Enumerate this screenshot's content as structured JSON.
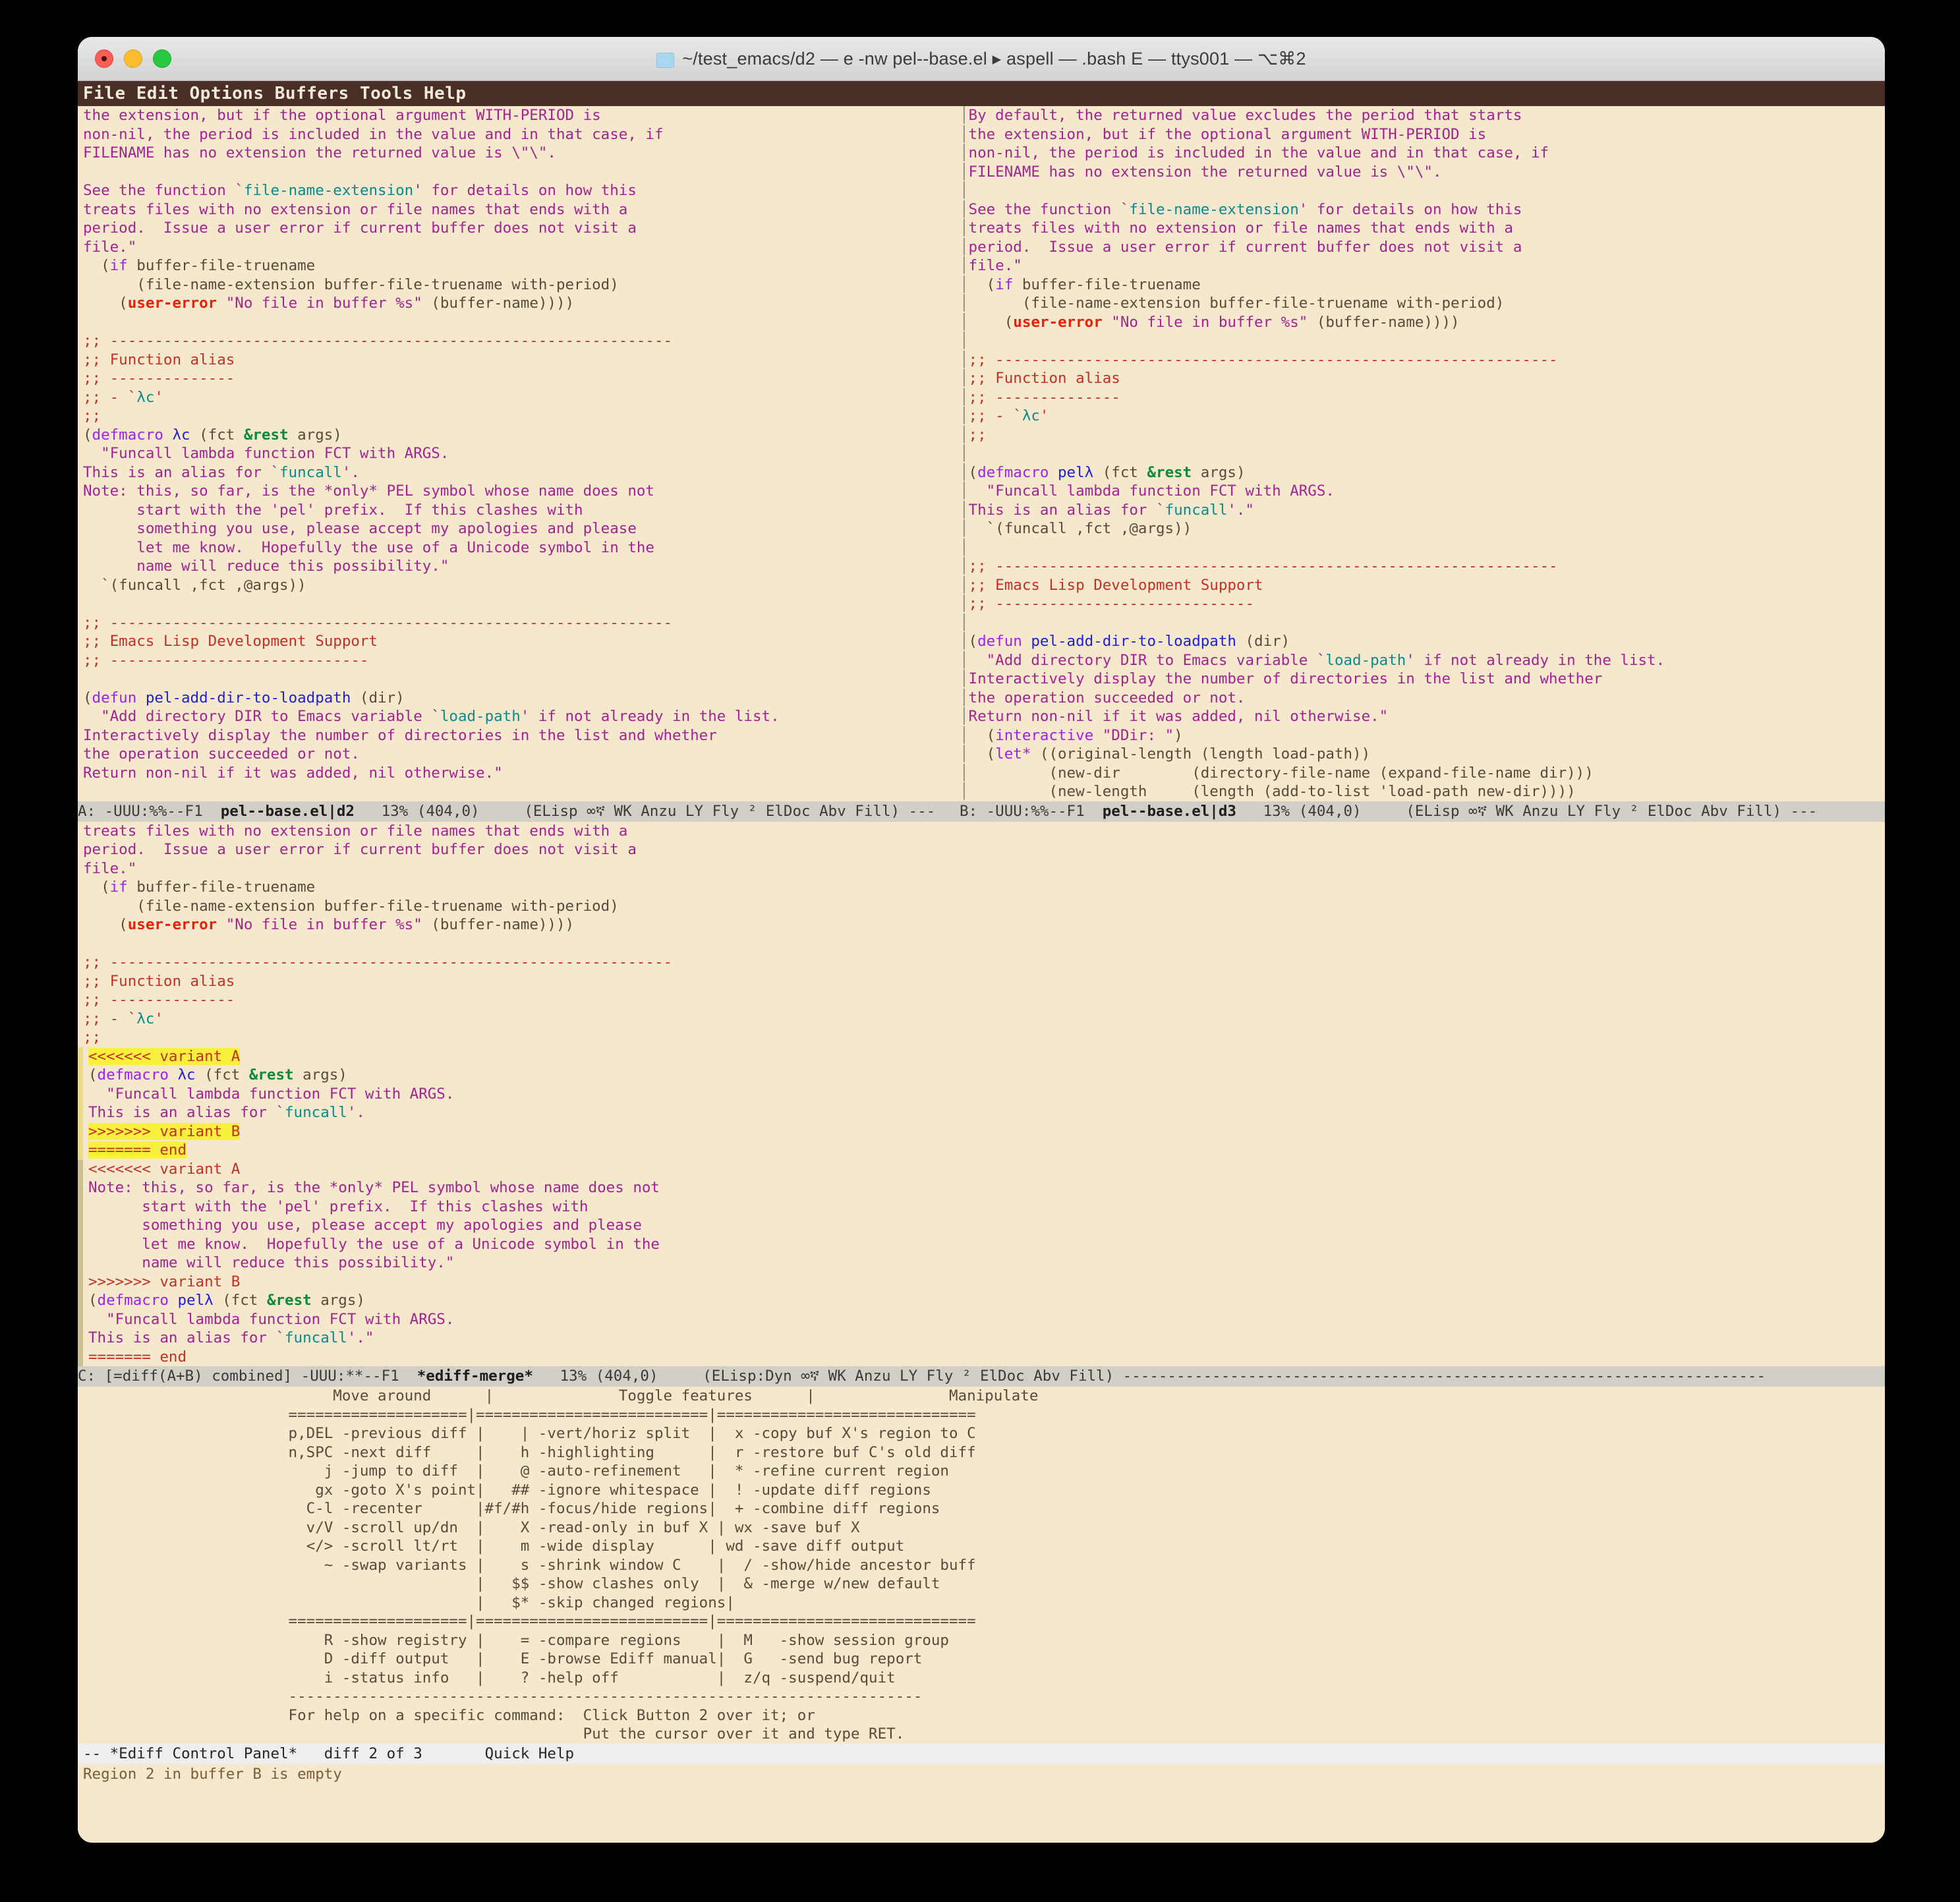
{
  "window": {
    "title": "~/test_emacs/d2 — e -nw pel--base.el ▸ aspell — .bash E — ttys001 — ⌥⌘2",
    "folder_icon": "folder-icon",
    "traffic_lights": [
      "close",
      "minimize",
      "zoom"
    ]
  },
  "menubar": "File Edit Options Buffers Tools Help",
  "panes": {
    "left": {
      "modeline": {
        "prefix": "A: -UUU:%%--F1  ",
        "buffer": "pel--base.el|d2",
        "suffix": "   13% (404,0)     (ELisp ∞ኛ WK Anzu LY Fly ² ElDoc Abv Fill) ---"
      },
      "lines": [
        {
          "t": "the extension, but if the optional argument WITH-PERIOD is",
          "c": "str"
        },
        {
          "t": "non-nil, the period is included in the value and in that case, if",
          "c": "str"
        },
        {
          "t": "FILENAME has no extension the returned value is \\\"\\\".",
          "c": "str"
        },
        {
          "t": "",
          "c": "plain"
        },
        {
          "t": "See the function `file-name-extension' for details on how this",
          "c": "str-sym"
        },
        {
          "t": "treats files with no extension or file names that ends with a",
          "c": "str"
        },
        {
          "t": "period.  Issue a user error if current buffer does not visit a",
          "c": "str"
        },
        {
          "t": "file.\"",
          "c": "str"
        },
        {
          "t": "  (if buffer-file-truename",
          "c": "code-if"
        },
        {
          "t": "      (file-name-extension buffer-file-truename with-period)",
          "c": "plain"
        },
        {
          "t": "    (user-error \"No file in buffer %s\" (buffer-name))))",
          "c": "code-err"
        },
        {
          "t": "",
          "c": "plain"
        },
        {
          "t": ";; ---------------------------------------------------------------",
          "c": "cmt"
        },
        {
          "t": ";; Function alias",
          "c": "cmt"
        },
        {
          "t": ";; --------------",
          "c": "cmt"
        },
        {
          "t": ";; - `λc'",
          "c": "cmt-sym"
        },
        {
          "t": ";;",
          "c": "cmt"
        },
        {
          "t": "",
          "c": "plain"
        }
      ]
    },
    "right": {
      "modeline": {
        "prefix": "B: -UUU:%%--F1  ",
        "buffer": "pel--base.el|d3",
        "suffix": "   13% (404,0)     (ELisp ∞ኛ WK Anzu LY Fly ² ElDoc Abv Fill) ---"
      }
    }
  },
  "merge_buffer": {
    "modeline": {
      "prefix": "C: [=diff(A+B) combined] -UUU:**--F1  ",
      "buffer": "*ediff-merge*",
      "suffix": "   13% (404,0)     (ELisp:Dyn ∞ኛ WK Anzu LY Fly ² ElDoc Abv Fill) ------------------------------------------------------------------------"
    },
    "conflict_markers": {
      "start": "<<<<<<< variant A",
      "mid": ">>>>>>> variant B",
      "end": "======= end"
    }
  },
  "control_panel": {
    "modeline": "-- *Ediff Control Panel*   diff 2 of 3       Quick Help",
    "minibuffer_message": "Region 2 in buffer B is empty",
    "help": {
      "headers": [
        "Move around",
        "Toggle features",
        "Manipulate"
      ],
      "separator": "====================",
      "rows": [
        [
          "p,DEL -previous diff",
          "| -vert/horiz split",
          "x -copy buf X's region to C"
        ],
        [
          "n,SPC -next diff",
          "h -highlighting",
          "r -restore buf C's old diff"
        ],
        [
          "j -jump to diff",
          "@ -auto-refinement",
          "* -refine current region"
        ],
        [
          "gx -goto X's point",
          "## -ignore whitespace",
          "! -update diff regions"
        ],
        [
          "C-l -recenter",
          "#f/#h -focus/hide regions",
          "+ -combine diff regions"
        ],
        [
          "v/V -scroll up/dn",
          "X -read-only in buf X",
          "wx -save buf X"
        ],
        [
          "</> -scroll lt/rt",
          "m -wide display",
          "wd -save diff output"
        ],
        [
          "~ -swap variants",
          "s -shrink window C",
          "/ -show/hide ancestor buff"
        ],
        [
          "",
          "$$ -show clashes only",
          "& -merge w/new default"
        ],
        [
          "",
          "$* -skip changed regions",
          ""
        ]
      ],
      "rows2": [
        [
          "R -show registry",
          "= -compare regions",
          "M   -show session group"
        ],
        [
          "D -diff output",
          "E -browse Ediff manual",
          "G   -send bug report"
        ],
        [
          "i -status info",
          "? -help off",
          "z/q -suspend/quit"
        ]
      ],
      "footer1": "For help on a specific command:  Click Button 2 over it; or",
      "footer2": "Put the cursor over it and type RET."
    }
  },
  "colors": {
    "background": "#f6e8cd",
    "menubar": "#4a2f29",
    "modeline": "#d2cfc6",
    "string": "#a2258f",
    "symbol": "#0b8a8a",
    "comment": "#c23127",
    "keyword": "#a020f0",
    "error": "#e8200a",
    "diff_current": "#fbd4e0",
    "diff_other": "#bfbfbf",
    "diff_empty": "#d4f5d4",
    "merge_variant_a": "#fbf6b8",
    "merge_marker": "#f8f03c"
  }
}
